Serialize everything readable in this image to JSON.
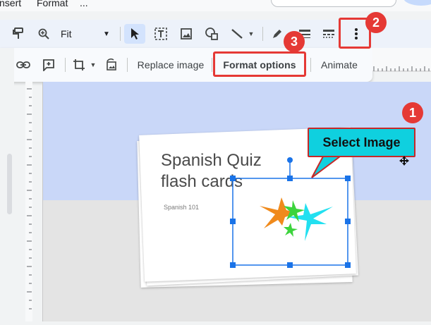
{
  "menu": {
    "insert": "nsert",
    "format": "Format",
    "more": "..."
  },
  "toolbar": {
    "zoom_label": "Fit"
  },
  "image_toolbar": {
    "replace_image": "Replace image",
    "format_options": "Format options",
    "animate": "Animate"
  },
  "slide": {
    "title": "Spanish Quiz\nflash cards",
    "subtitle": "Spanish 101"
  },
  "annotations": {
    "callout": "Select Image",
    "step1": "1",
    "step2": "2",
    "step3": "3"
  },
  "colors": {
    "callout_fill": "#0fd0df",
    "badge_red": "#e53935",
    "selection_blue": "#1a73e8",
    "star_orange": "#f08a1c",
    "star_cyan": "#22e0f0",
    "star_green": "#3cd43c"
  }
}
